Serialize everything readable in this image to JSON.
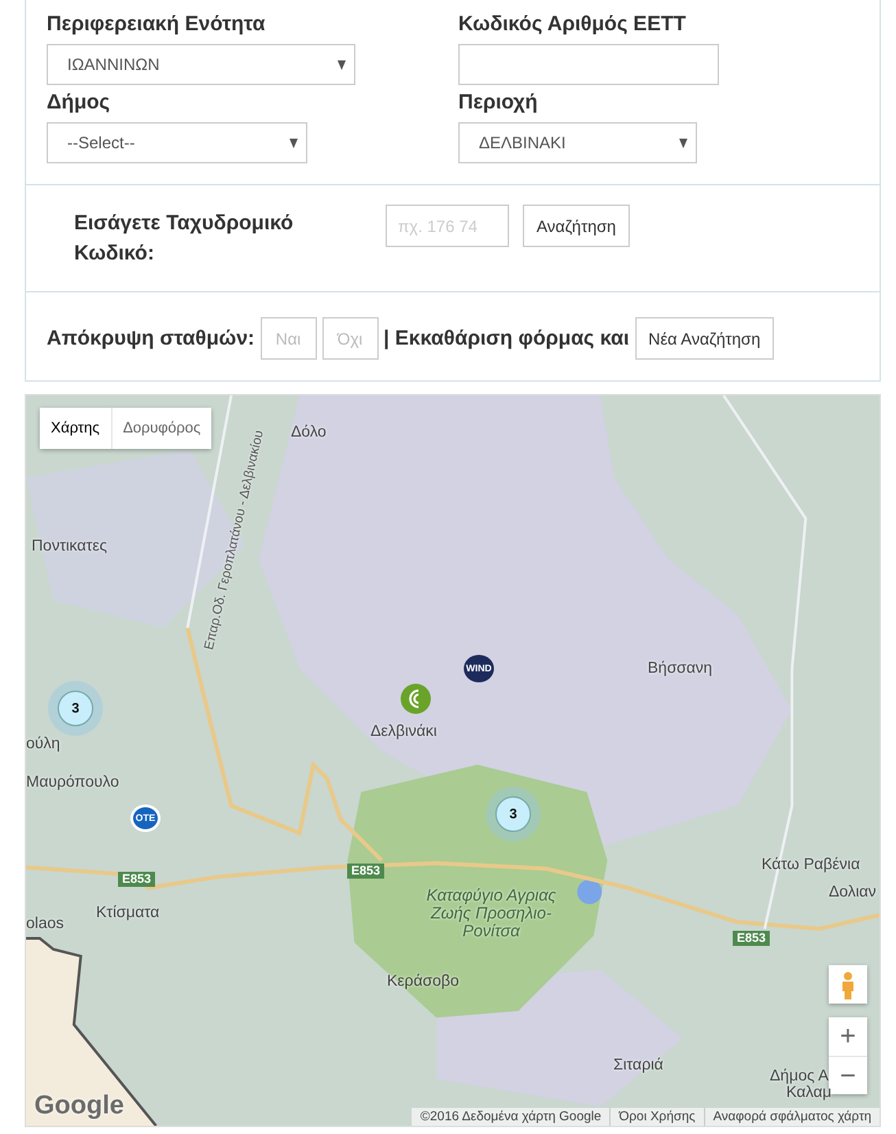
{
  "form": {
    "fields": [
      {
        "kind": "select",
        "label": "Περιφερειακή Ενότητα",
        "value": "ΙΩΑΝΝΙΝΩΝ"
      },
      {
        "kind": "input",
        "label": "Κωδικός Αριθμός ΕΕΤΤ"
      },
      {
        "kind": "select",
        "label": "Δήμος",
        "value": "--Select--"
      },
      {
        "kind": "select",
        "label": "Περιοχή",
        "value": "ΔΕΛΒΙΝΑΚΙ"
      }
    ]
  },
  "postal": {
    "label": "Εισάγετε Ταχυδρομικό Κωδικό:",
    "placeholder": "πχ. 176 74",
    "button": "Αναζήτηση"
  },
  "hide_stations": {
    "label": "Απόκρυψη σταθμών:",
    "options": [
      "Ναι",
      "Όχι"
    ],
    "clear_label": "| Εκκαθάριση φόρμας και",
    "new_search_button": "Νέα Αναζήτηση"
  },
  "map": {
    "map_types": [
      {
        "label": "Χάρτης",
        "selected": true
      },
      {
        "label": "Δορυφόρος",
        "selected": false
      }
    ],
    "places": [
      {
        "kind": "town",
        "label": "Δόλο"
      },
      {
        "kind": "road",
        "label": "Επαρ.Οδ. Γεροπλατάνου - Δελβινακίου"
      },
      {
        "kind": "town",
        "label": "Ποντικατες"
      },
      {
        "kind": "town",
        "label": "Βήσσανη"
      },
      {
        "kind": "town",
        "label": "Δελβινάκι"
      },
      {
        "kind": "town",
        "label": "ούλη"
      },
      {
        "kind": "town",
        "label": "Μαυρόπουλο"
      },
      {
        "kind": "shield",
        "label": "E853"
      },
      {
        "kind": "shield",
        "label": "E853"
      },
      {
        "kind": "town",
        "label": "Κάτω Ραβένια"
      },
      {
        "kind": "town",
        "label": "Δολιαν"
      },
      {
        "kind": "town",
        "label": "Κτίσματα"
      },
      {
        "kind": "town",
        "label": "olaos"
      },
      {
        "kind": "park",
        "label": "Καταφύγιο Αγριας Ζωής Προσηλιο-Ρονίτσα"
      },
      {
        "kind": "shield",
        "label": "E853"
      },
      {
        "kind": "town",
        "label": "Κεράσοβο"
      },
      {
        "kind": "town",
        "label": "Σιταριά"
      },
      {
        "kind": "town",
        "label": "Δήμος Α"
      },
      {
        "kind": "town",
        "label": "Καλαμ"
      }
    ],
    "markers": [
      {
        "kind": "cluster",
        "label": "3"
      },
      {
        "kind": "cluster",
        "label": "3"
      },
      {
        "kind": "operator",
        "label": "OTE",
        "color": "#1565c0"
      },
      {
        "kind": "operator",
        "label": "WIND",
        "color": "#1d2b5c"
      },
      {
        "kind": "station",
        "color": "#6aa32a"
      }
    ],
    "zoom_in": "+",
    "zoom_out": "−",
    "logo": "Google",
    "attribution": [
      "©2016 Δεδομένα χάρτη Google",
      "Όροι Χρήσης",
      "Αναφορά σφάλματος χάρτη"
    ]
  }
}
